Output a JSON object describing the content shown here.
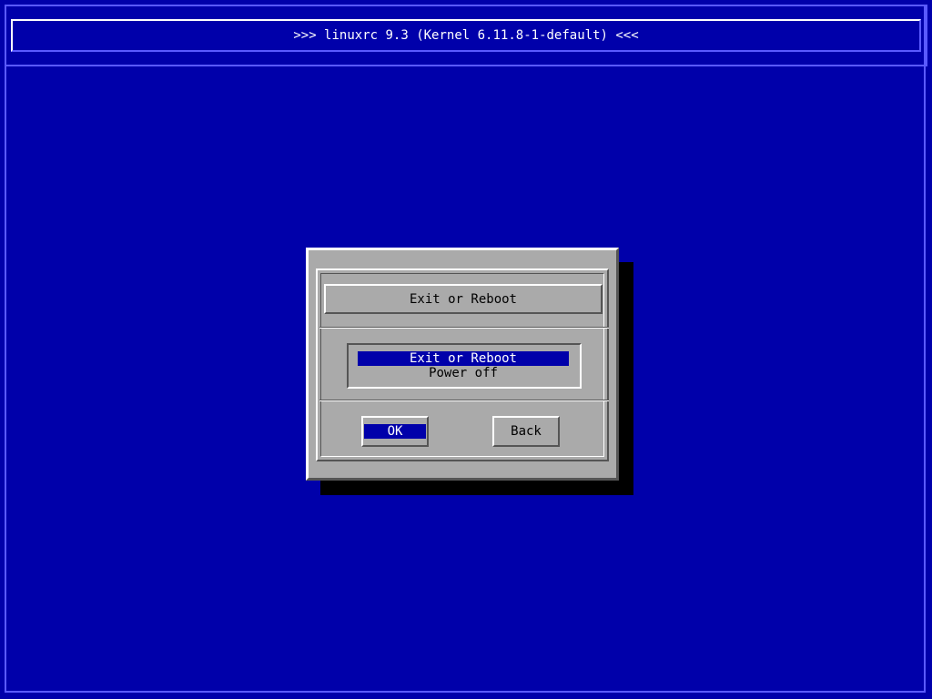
{
  "screen": {
    "title": ">>> linuxrc 9.3 (Kernel 6.11.8-1-default) <<<",
    "background_color": "#0000aa"
  },
  "dialog": {
    "title": "Exit or Reboot",
    "options": [
      {
        "label": "Exit or Reboot",
        "selected": true
      },
      {
        "label": "Power off",
        "selected": false
      }
    ],
    "buttons": {
      "ok_label": "OK",
      "back_label": "Back"
    },
    "focused_button": "OK"
  }
}
